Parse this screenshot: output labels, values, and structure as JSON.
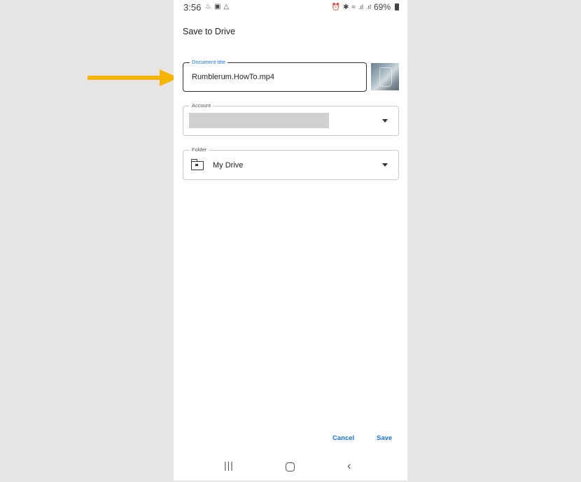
{
  "status_bar": {
    "time": "3:56",
    "battery": "69%",
    "left_icons": [
      "notification-icon",
      "gallery-icon",
      "drive-icon"
    ],
    "right_icons": [
      "alarm-icon",
      "bluetooth-icon",
      "wifi-icon",
      "signal-icon",
      "signal-icon",
      "battery-icon"
    ]
  },
  "dialog": {
    "title": "Save to Drive",
    "document_title": {
      "label": "Document title",
      "value": "Rumblerum.HowTo.mp4"
    },
    "account": {
      "label": "Account",
      "value": ""
    },
    "folder": {
      "label": "Folder",
      "value": "My Drive"
    },
    "buttons": {
      "cancel": "Cancel",
      "save": "Save"
    }
  },
  "colors": {
    "accent": "#1a73e8",
    "annotation_arrow": "#f5b400",
    "background": "#e7e4e4"
  }
}
